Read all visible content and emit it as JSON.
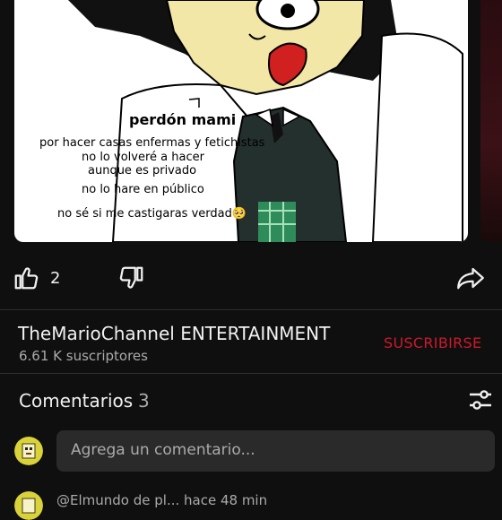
{
  "media": {
    "overlay": {
      "title": "perdón mami",
      "lines": [
        "por hacer casas enfermas y fetichistas",
        "no lo volveré a hacer",
        "aunque es privado",
        "no lo hare en público",
        "no sé si me castigaras verdad🥺"
      ]
    }
  },
  "actions": {
    "like_count": "2"
  },
  "channel": {
    "name": "TheMarioChannel ENTERTAINMENT",
    "subscribers": "6.61 K suscriptores",
    "subscribe_label": "SUSCRIBIRSE"
  },
  "comments": {
    "title": "Comentarios",
    "count": "3",
    "input_placeholder": "Agrega un comentario...",
    "next_preview": "@Elmundo de pl... hace 48 min"
  },
  "colors": {
    "background": "#0f0f0f",
    "subscribe": "#cc1a2b",
    "input_bg": "#2a2a2a",
    "secondary_text": "#aaaaaa"
  }
}
